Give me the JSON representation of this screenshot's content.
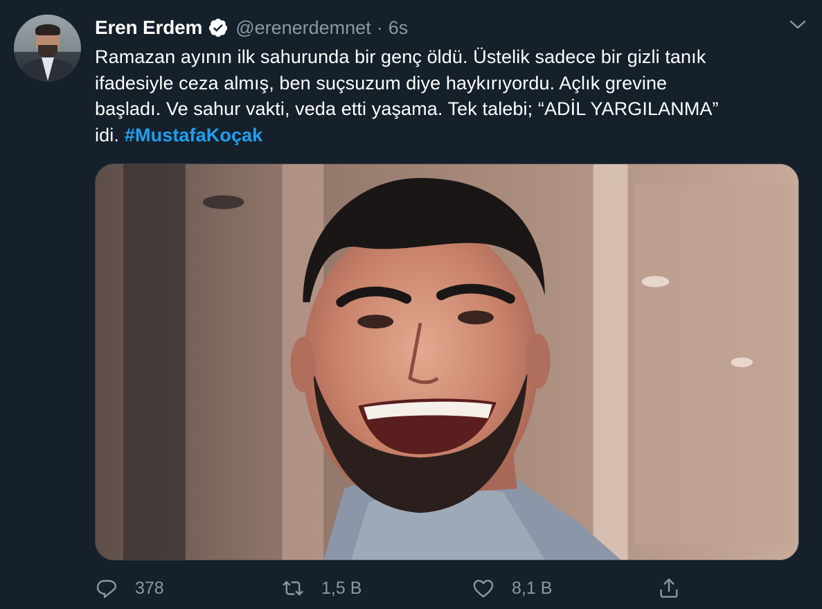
{
  "author": {
    "name": "Eren Erdem",
    "handle": "@erenerdemnet",
    "separator": "·",
    "time": "6s",
    "verified": true
  },
  "tweet": {
    "lines": [
      "Ramazan ayının ilk sahurunda bir genç öldü. Üstelik sadece bir gizli tanık",
      "ifadesiyle ceza almış, ben suçsuzum diye haykırıyordu. Açlık grevine",
      "başladı. Ve sahur vakti, veda etti yaşama. Tek talebi; “ADİL YARGILANMA”",
      "idi."
    ],
    "hashtag": "#MustafaKoçak"
  },
  "actions": {
    "reply_count": "378",
    "retweet_count": "1,5 B",
    "like_count": "8,1 B"
  },
  "icons": {
    "verified": "verified-badge-icon",
    "caret": "chevron-down-icon",
    "reply": "reply-icon",
    "retweet": "retweet-icon",
    "like": "heart-icon",
    "share": "share-icon"
  },
  "colors": {
    "background": "#15202b",
    "text": "#ffffff",
    "muted": "#8899a6",
    "link": "#1da1f2",
    "border": "#38444d"
  }
}
